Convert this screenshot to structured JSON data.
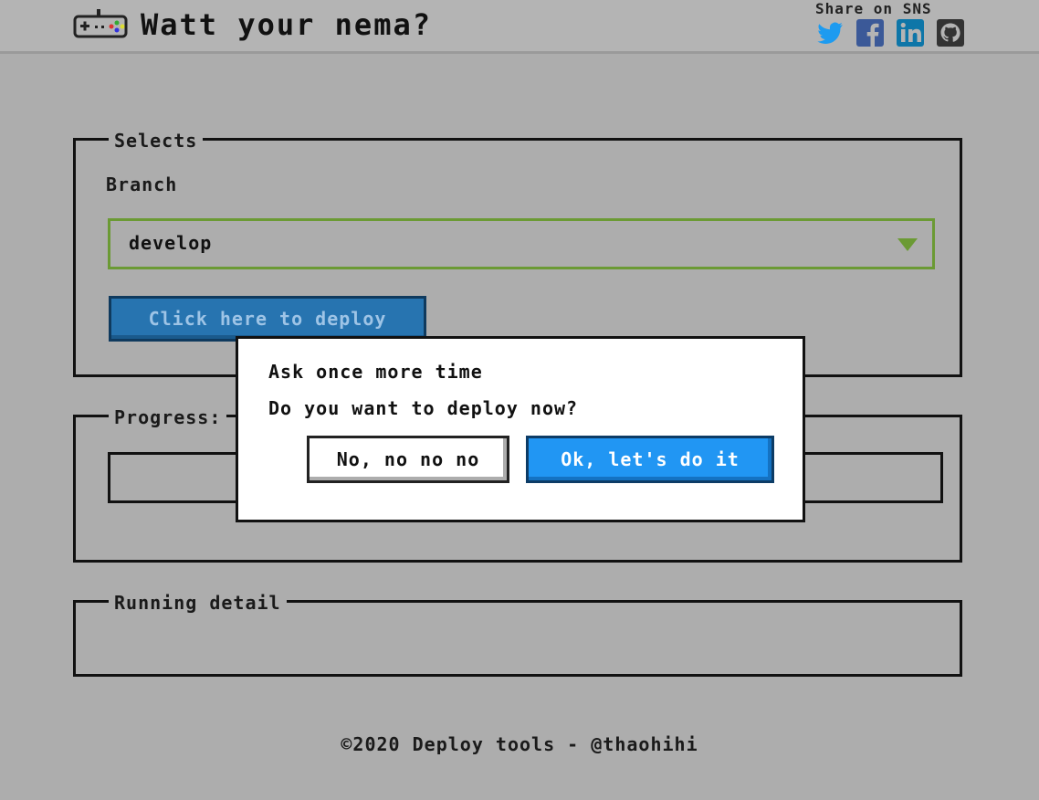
{
  "header": {
    "brand": "Watt your nema?",
    "share_label": "Share on SNS",
    "logo_icon": "gamepad-icon",
    "sns": [
      {
        "name": "twitter-icon",
        "color": "#1d9bf0"
      },
      {
        "name": "facebook-icon",
        "color": "#3b5998"
      },
      {
        "name": "linkedin-icon",
        "color": "#0e76a8"
      },
      {
        "name": "github-icon",
        "color": "#333333"
      }
    ]
  },
  "selects": {
    "legend": "Selects",
    "branch_label": "Branch",
    "branch_value": "develop",
    "deploy_label": "Click here to deploy"
  },
  "progress": {
    "legend": "Progress:"
  },
  "running": {
    "legend": "Running detail"
  },
  "modal": {
    "title": "Ask once more time",
    "text": "Do you want to deploy now?",
    "no_label": "No, no no no",
    "ok_label": "Ok, let's do it"
  },
  "footer": {
    "text": "©2020 Deploy tools - @thaohihi"
  },
  "colors": {
    "background": "#adadad",
    "accent_green": "#6b9a34",
    "primary_blue": "#2196f3",
    "deploy_blue": "#2774b0"
  }
}
